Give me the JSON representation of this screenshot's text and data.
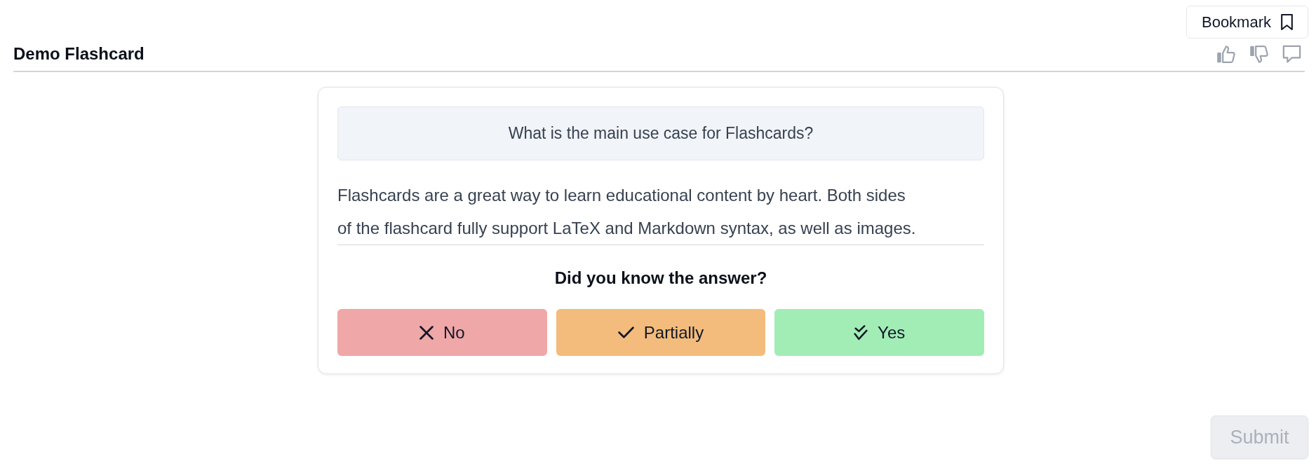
{
  "header": {
    "title": "Demo Flashcard",
    "bookmark": {
      "label": "Bookmark",
      "bookmarked": false
    }
  },
  "card": {
    "question": "What is the main use case for Flashcards?",
    "answer": "Flashcards are a great way to learn educational content by heart. Both sides of the flashcard fully support LaTeX and Markdown syntax, as well as images.",
    "prompt": "Did you know the answer?",
    "choices": [
      {
        "label": "No",
        "kind": "negative",
        "color": "#efa7a7",
        "selected": false
      },
      {
        "label": "Partially",
        "kind": "partial",
        "color": "#f3bc7c",
        "selected": false
      },
      {
        "label": "Yes",
        "kind": "positive",
        "color": "#a1edb5",
        "selected": false
      }
    ]
  },
  "submit": {
    "label": "Submit",
    "disabled": true
  }
}
